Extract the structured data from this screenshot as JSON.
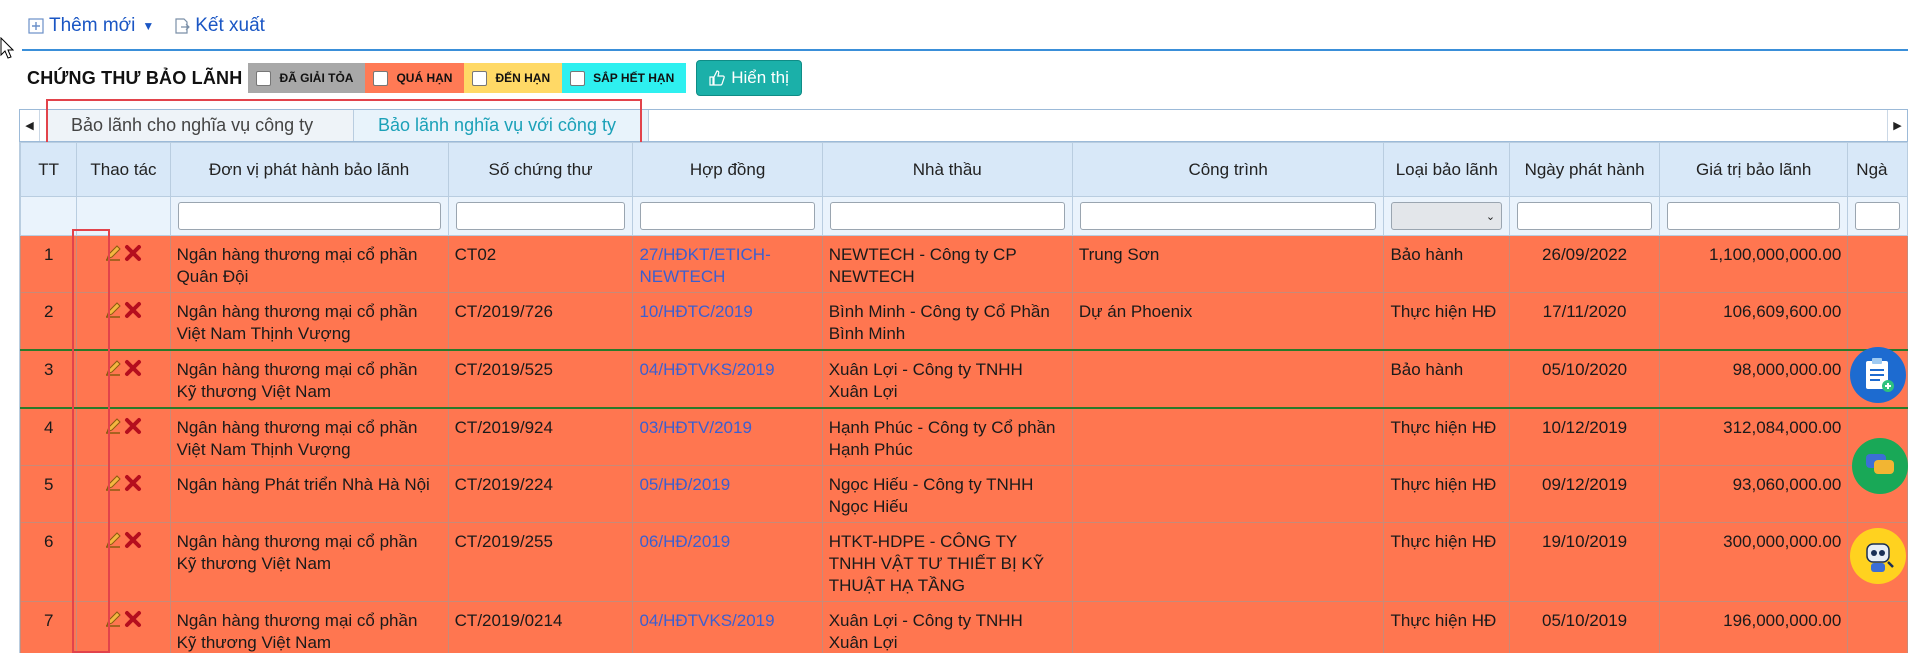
{
  "toolbar": {
    "add_label": "Thêm mới",
    "export_label": "Kết xuất"
  },
  "filters": {
    "title": "CHỨNG THƯ BẢO LÃNH",
    "statuses": [
      {
        "label": "ĐÃ GIẢI TỎA",
        "color": "#a8a8a8"
      },
      {
        "label": "QUÁ HẠN",
        "color": "#ff7a55"
      },
      {
        "label": "ĐẾN HẠN",
        "color": "#ffd966"
      },
      {
        "label": "SẮP HẾT HẠN",
        "color": "#2ef0f0"
      }
    ],
    "show_button": "Hiển thị"
  },
  "tabs": [
    {
      "label": "Bảo lãnh cho nghĩa vụ công ty",
      "active": false
    },
    {
      "label": "Bảo lãnh nghĩa vụ với công ty",
      "active": true
    }
  ],
  "table": {
    "columns": [
      "TT",
      "Thao tác",
      "Đơn vị phát hành bảo lãnh",
      "Số chứng thư",
      "Hợp đồng",
      "Nhà thầu",
      "Công trình",
      "Loại bảo lãnh",
      "Ngày phát hành",
      "Giá trị bảo lãnh",
      "Ngà"
    ],
    "rows": [
      {
        "tt": "1",
        "issuer": "Ngân hàng thương mại cổ phần Quân Đội",
        "cert": "CT02",
        "contract": "27/HĐKT/ETICH-NEWTECH",
        "contractor": "NEWTECH - Công ty CP NEWTECH",
        "project": "Trung Sơn",
        "type": "Bảo hành",
        "date": "26/09/2022",
        "value": "1,100,000,000.00"
      },
      {
        "tt": "2",
        "issuer": "Ngân hàng thương mại cổ phần Việt Nam Thịnh Vượng",
        "cert": "CT/2019/726",
        "contract": "10/HĐTC/2019",
        "contractor": "Bình Minh - Công ty Cổ Phần Bình Minh",
        "project": "Dự án Phoenix",
        "type": "Thực hiện HĐ",
        "date": "17/11/2020",
        "value": "106,609,600.00"
      },
      {
        "tt": "3",
        "issuer": "Ngân hàng thương mại cổ phần Kỹ thương Việt Nam",
        "cert": "CT/2019/525",
        "contract": "04/HĐTVKS/2019",
        "contractor": "Xuân Lợi - Công ty TNHH Xuân Lợi",
        "project": "",
        "type": "Bảo hành",
        "date": "05/10/2020",
        "value": "98,000,000.00"
      },
      {
        "tt": "4",
        "issuer": "Ngân hàng thương mại cổ phần Việt Nam Thịnh Vượng",
        "cert": "CT/2019/924",
        "contract": "03/HĐTV/2019",
        "contractor": "Hạnh Phúc - Công ty Cổ phần Hạnh Phúc",
        "project": "",
        "type": "Thực hiện HĐ",
        "date": "10/12/2019",
        "value": "312,084,000.00"
      },
      {
        "tt": "5",
        "issuer": "Ngân hàng Phát triển Nhà Hà Nội",
        "cert": "CT/2019/224",
        "contract": "05/HĐ/2019",
        "contractor": "Ngọc Hiếu - Công ty TNHH Ngọc Hiếu",
        "project": "",
        "type": "Thực hiện HĐ",
        "date": "09/12/2019",
        "value": "93,060,000.00"
      },
      {
        "tt": "6",
        "issuer": "Ngân hàng thương mại cổ phần Kỹ thương Việt Nam",
        "cert": "CT/2019/255",
        "contract": "06/HĐ/2019",
        "contractor": "HTKT-HDPE - CÔNG TY TNHH VẬT TƯ THIẾT BỊ KỸ THUẬT HẠ TẦNG",
        "project": "",
        "type": "Thực hiện HĐ",
        "date": "19/10/2019",
        "value": "300,000,000.00"
      },
      {
        "tt": "7",
        "issuer": "Ngân hàng thương mại cổ phần Kỹ thương Việt Nam",
        "cert": "CT/2019/0214",
        "contract": "04/HĐTVKS/2019",
        "contractor": "Xuân Lợi - Công ty TNHH Xuân Lợi",
        "project": "",
        "type": "Thực hiện HĐ",
        "date": "05/10/2019",
        "value": "196,000,000.00"
      }
    ]
  },
  "colors": {
    "overdue_row": "#ff7650",
    "header_bg": "#d8e8f8",
    "link": "#3b5fd0",
    "accent_teal": "#1bb0a9"
  }
}
